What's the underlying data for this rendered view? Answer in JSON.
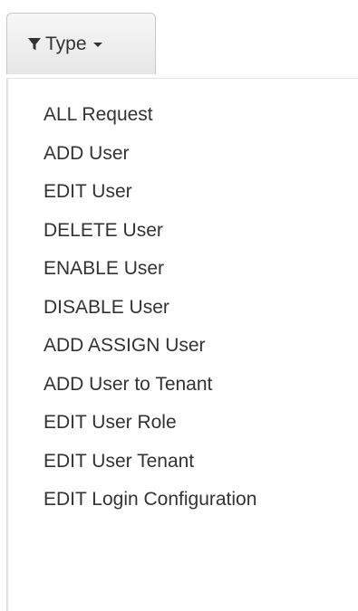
{
  "filter": {
    "label": "Type",
    "icon": "filter-icon",
    "caret_icon": "caret-down-icon"
  },
  "menu": {
    "items": [
      {
        "label": "ALL Request"
      },
      {
        "label": "ADD User"
      },
      {
        "label": "EDIT User"
      },
      {
        "label": "DELETE User"
      },
      {
        "label": "ENABLE User"
      },
      {
        "label": "DISABLE User"
      },
      {
        "label": "ADD ASSIGN User"
      },
      {
        "label": "ADD User to Tenant"
      },
      {
        "label": "EDIT User Role"
      },
      {
        "label": "EDIT User Tenant"
      },
      {
        "label": "EDIT Login Configuration"
      }
    ]
  },
  "colors": {
    "text": "#333333",
    "button_border": "#c8c8c8"
  }
}
